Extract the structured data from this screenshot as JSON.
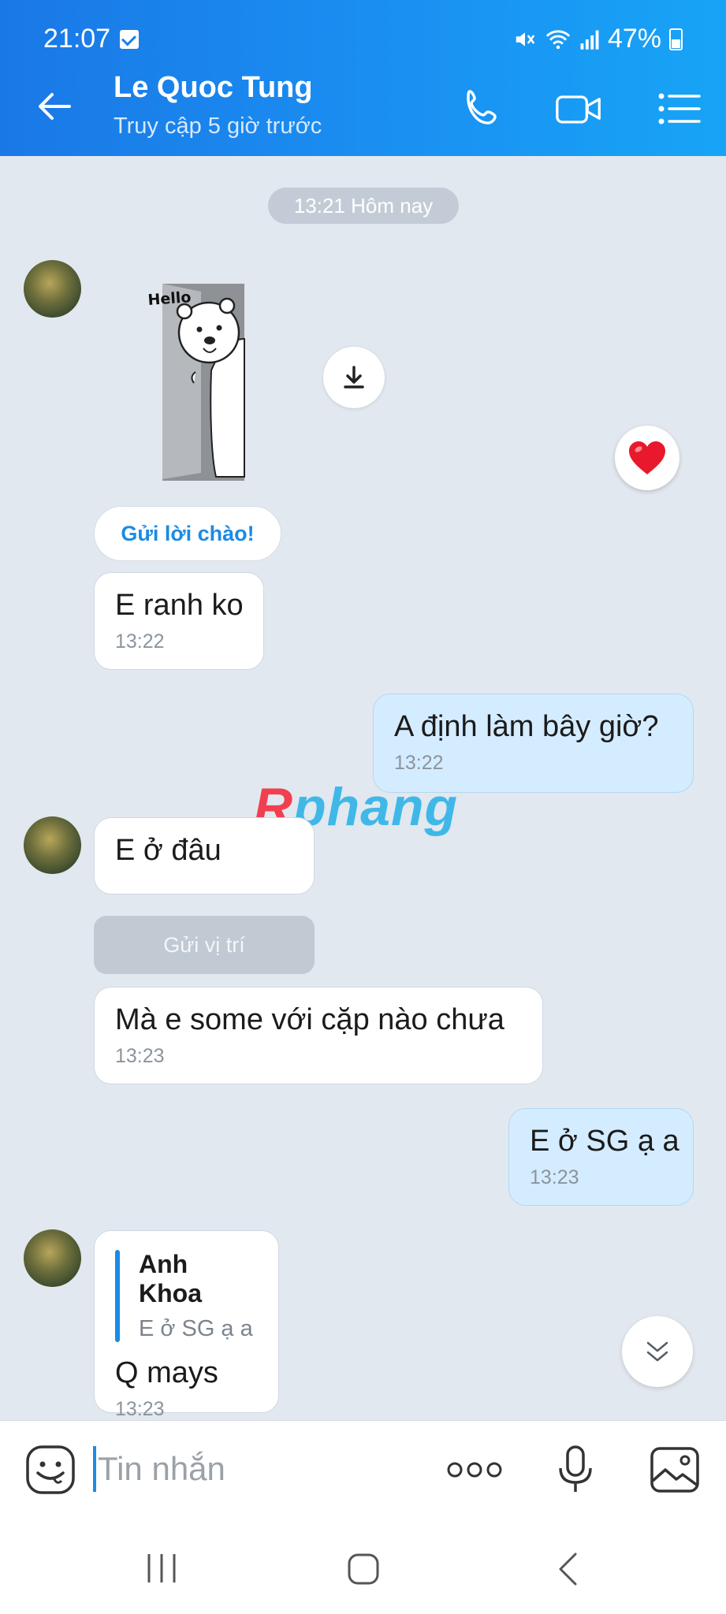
{
  "status_bar": {
    "time": "21:07",
    "battery": "47%"
  },
  "header": {
    "contact_name": "Le Quoc Tung",
    "last_seen": "Truy cập 5 giờ trước"
  },
  "chat": {
    "date_divider": "13:21 Hôm nay",
    "sticker_text": "Hello",
    "greet_chip": "Gửi lời chào!",
    "location_button": "Gửi vị trí",
    "messages": [
      {
        "text": "E ranh ko",
        "time": "13:22"
      },
      {
        "text": "A định làm bây giờ?",
        "time": "13:22"
      },
      {
        "text": "E ở đâu"
      },
      {
        "text": "Mà e some với cặp nào chưa",
        "time": "13:23"
      },
      {
        "text": "E ở SG ạ a",
        "time": "13:23"
      },
      {
        "quote_name": "Anh Khoa",
        "quote_text": "E ở SG ạ a",
        "text": "Q mays",
        "time": "13:23"
      }
    ]
  },
  "watermark": {
    "r": "R",
    "rest": "phang"
  },
  "composer": {
    "placeholder": "Tin nhắn"
  },
  "icons": {
    "back": "arrow-left-icon",
    "call": "phone-icon",
    "video": "video-camera-icon",
    "menu": "list-menu-icon",
    "download": "download-icon",
    "reaction": "heart-icon",
    "scroll": "chevron-double-down-icon",
    "emoji": "emoji-icon",
    "more": "more-icon",
    "mic": "microphone-icon",
    "image": "image-icon"
  },
  "colors": {
    "header_gradient_start": "#1a78e6",
    "header_gradient_end": "#17a4f6",
    "accent": "#1a8be6",
    "outgoing_bubble": "#d4ecff",
    "chat_background": "#e2e8ef"
  }
}
